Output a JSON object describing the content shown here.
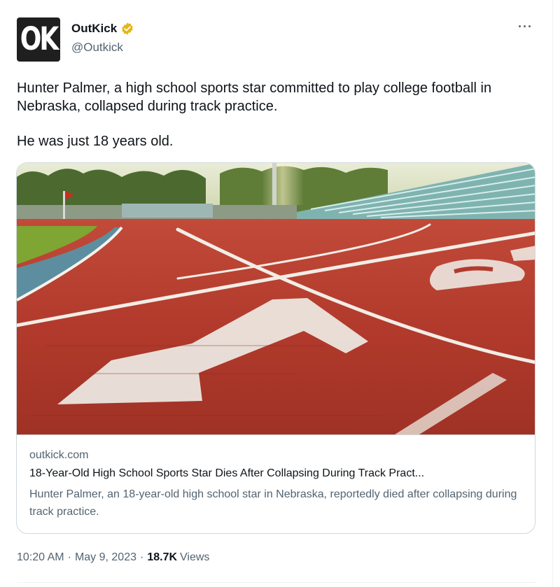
{
  "author": {
    "avatar_text": "OK",
    "display_name": "OutKick",
    "handle": "@Outkick",
    "verified_badge_color": "#e2b719",
    "more_icon": "more-dots-icon"
  },
  "tweet": {
    "paragraphs": [
      "Hunter Palmer, a high school sports star committed to play college football in Nebraska, collapsed during track practice.",
      "He was just 18 years old."
    ]
  },
  "card": {
    "image_subject": "track-lanes-photo",
    "domain": "outkick.com",
    "title": "18-Year-Old High School Sports Star Dies After Collapsing During Track Pract...",
    "description": "Hunter Palmer, an 18-year-old high school star in Nebraska, reportedly died after collapsing during track practice."
  },
  "meta": {
    "time": "10:20 AM",
    "separator": "·",
    "date": "May 9, 2023",
    "views_count": "18.7K",
    "views_label": "Views"
  },
  "colors": {
    "text_primary": "#0f1419",
    "text_secondary": "#536471",
    "border": "#cfd9de",
    "track": "#b83b2e"
  }
}
